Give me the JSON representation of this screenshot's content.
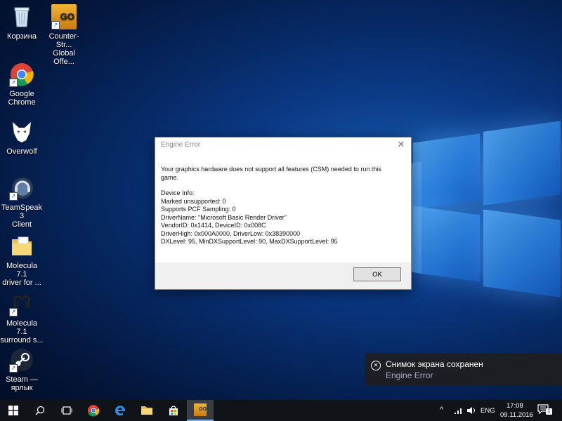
{
  "desktop": {
    "icons": [
      {
        "label1": "Корзина",
        "label2": ""
      },
      {
        "label1": "Counter-Str...",
        "label2": "Global Offe..."
      },
      {
        "label1": "Google",
        "label2": "Chrome"
      },
      {
        "label1": "Overwolf",
        "label2": ""
      },
      {
        "label1": "TeamSpeak 3",
        "label2": "Client"
      },
      {
        "label1": "Molecula 7.1",
        "label2": "driver for ..."
      },
      {
        "label1": "Molecula 7.1",
        "label2": "surround s..."
      },
      {
        "label1": "Steam —",
        "label2": "ярлык"
      }
    ],
    "csgo_badge": "GO"
  },
  "dialog": {
    "title": "Engine Error",
    "close": "✕",
    "message_line1": "Your graphics hardware does not support all features (CSM) needed to run this",
    "message_line2": "game.",
    "info": [
      "Device Info:",
      "Marked unsupported: 0",
      "Supports PCF Sampling: 0",
      "DriverName: \"Microsoft Basic Render Driver\"",
      "VendorID: 0x1414, DeviceID: 0x008C",
      "DriverHigh: 0x000A0000, DriverLow: 0x38390000",
      "DXLevel: 95, MinDXSupportLevel: 90, MaxDXSupportLevel: 95"
    ],
    "ok_label": "OK"
  },
  "toast": {
    "title": "Снимок экрана сохранен",
    "subtitle": "Engine Error"
  },
  "taskbar": {
    "language": "ENG",
    "time": "17:08",
    "date": "09.11.2016",
    "notification_count": "1"
  }
}
